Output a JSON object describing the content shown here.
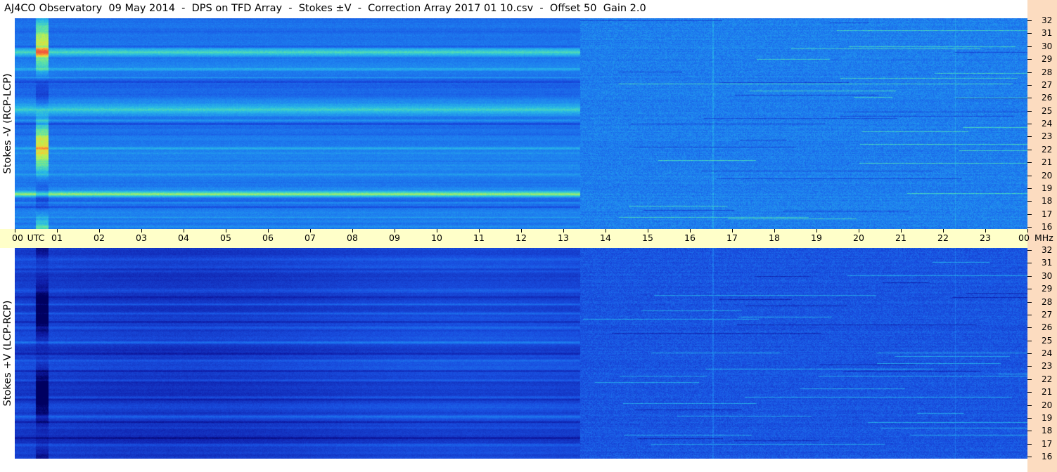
{
  "title": "AJ4CO Observatory  09 May 2014  -  DPS on TFD Array  -  Stokes ±V  -  Correction Array 2017 01 10.csv  -  Offset 50  Gain 2.0",
  "chart_data": {
    "type": "heatmap",
    "panels": [
      {
        "name": "Stokes -V (RCP-LCP)",
        "ylabel": "Stokes -V (RCP-LCP)"
      },
      {
        "name": "Stokes +V (LCP-RCP)",
        "ylabel": "Stokes +V (LCP-RCP)"
      }
    ],
    "x_axis": {
      "ticks": [
        "00",
        "UTC",
        "01",
        "02",
        "03",
        "04",
        "05",
        "06",
        "07",
        "08",
        "09",
        "10",
        "11",
        "12",
        "13",
        "14",
        "15",
        "16",
        "17",
        "18",
        "19",
        "20",
        "21",
        "22",
        "23",
        "00"
      ],
      "unit": "MHz",
      "range_hours": [
        0,
        24
      ]
    },
    "y_axis": {
      "ticks": [
        "16",
        "17",
        "18",
        "19",
        "20",
        "21",
        "22",
        "23",
        "24",
        "25",
        "26",
        "27",
        "28",
        "29",
        "30",
        "31",
        "32"
      ],
      "range": [
        16,
        32
      ]
    },
    "colors": {
      "background_low": "#1a3fd0",
      "background_mid": "#1e78f0",
      "band": "#2ec0e6",
      "hot": "#f07050",
      "freq_strip": "#fcdcc0",
      "time_bar": "#ffffc9"
    }
  }
}
